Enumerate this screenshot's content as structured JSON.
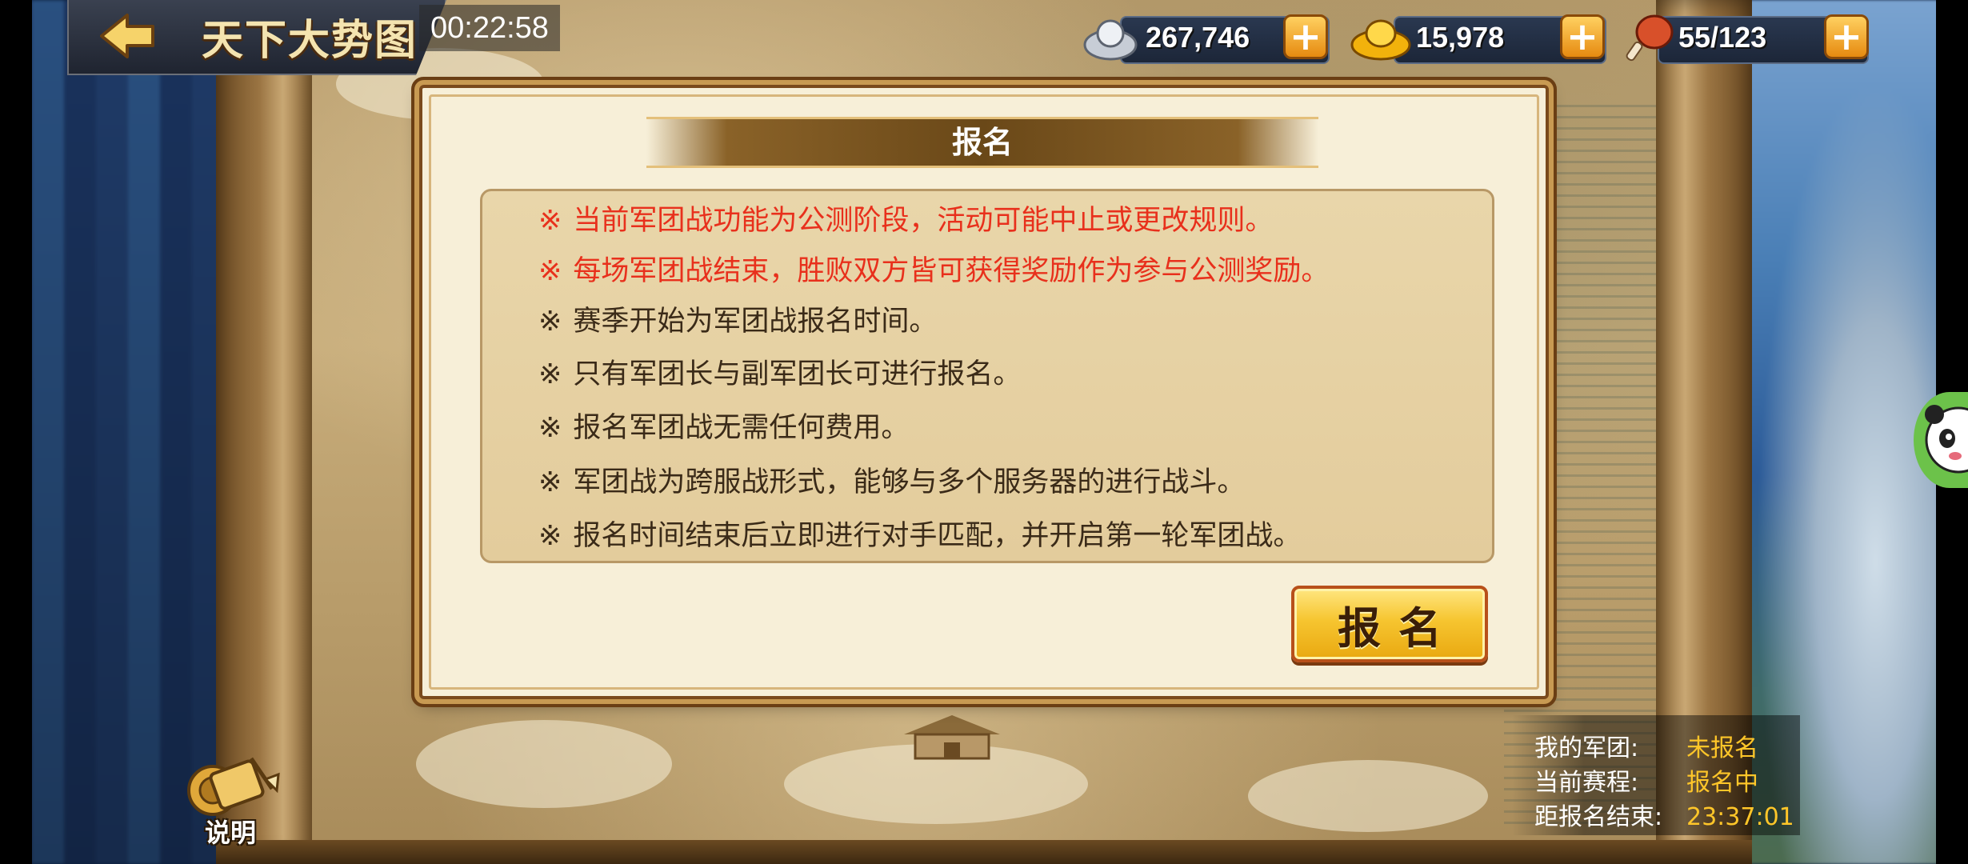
{
  "header": {
    "title": "天下大势图",
    "clock": "00:22:58"
  },
  "currencies": [
    {
      "name": "silver",
      "icon": "silver-ingot-icon",
      "value": "267,746"
    },
    {
      "name": "gold",
      "icon": "gold-ingot-icon",
      "value": "15,978"
    },
    {
      "name": "stamina",
      "icon": "meat-drumstick-icon",
      "value": "55/123"
    }
  ],
  "dialog": {
    "title": "报名",
    "rules": [
      {
        "text": "当前军团战功能为公测阶段，活动可能中止或更改规则。",
        "color": "#e8301c"
      },
      {
        "text": "每场军团战结束，胜败双方皆可获得奖励作为参与公测奖励。",
        "color": "#e8301c"
      },
      {
        "text": "赛季开始为军团战报名时间。",
        "color": "#3a2a18"
      },
      {
        "text": "只有军团长与副军团长可进行报名。",
        "color": "#3a2a18"
      },
      {
        "text": "报名军团战无需任何费用。",
        "color": "#3a2a18"
      },
      {
        "text": "军团战为跨服战形式，能够与多个服务器的进行战斗。",
        "color": "#3a2a18"
      },
      {
        "text": "报名时间结束后立即进行对手匹配，并开启第一轮军团战。",
        "color": "#3a2a18"
      }
    ],
    "rule_mark": "※",
    "signup_button": "报名"
  },
  "explain": {
    "label": "说明"
  },
  "info": {
    "my_legion_label": "我的军团:",
    "my_legion_value": "未报名",
    "stage_label": "当前赛程:",
    "stage_value": "报名中",
    "countdown_label": "距报名结束:",
    "countdown_value": "23:37:01"
  }
}
